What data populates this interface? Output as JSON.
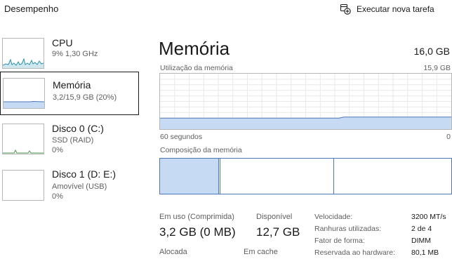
{
  "header": {
    "title": "Desempenho",
    "run_task_label": "Executar nova tarefa",
    "run_task_icon": "new-task-icon"
  },
  "sidebar": {
    "items": [
      {
        "title": "CPU",
        "sub1": "9%  1,30 GHz",
        "sub2": ""
      },
      {
        "title": "Memória",
        "sub1": "3,2/15,9 GB (20%)",
        "sub2": ""
      },
      {
        "title": "Disco 0 (C:)",
        "sub1": "SSD (RAID)",
        "sub2": "0%"
      },
      {
        "title": "Disco 1 (D: E:)",
        "sub1": "Amovível (USB)",
        "sub2": "0%"
      }
    ]
  },
  "main": {
    "title": "Memória",
    "total": "16,0 GB",
    "usage_label": "Utilização da memória",
    "usage_max": "15,9 GB",
    "time_span": "60 segundos",
    "time_end": "0",
    "composition_label": "Composição da memória",
    "usage_fraction": 0.2,
    "composition": {
      "in_use_gb": 3.2,
      "modified_gb": 0.0,
      "standby_gb": 6.2,
      "free_gb": 6.5,
      "total_gb": 15.9
    }
  },
  "stats": {
    "in_use_label": "Em uso (Comprimida)",
    "in_use_value": "3,2 GB (0 MB)",
    "available_label": "Disponível",
    "available_value": "12,7 GB",
    "committed_label": "Alocada",
    "cached_label": "Em cache"
  },
  "details": [
    {
      "key": "Velocidade:",
      "value": "3200 MT/s"
    },
    {
      "key": "Ranhuras utilizadas:",
      "value": "2 de 4"
    },
    {
      "key": "Fator de forma:",
      "value": "DIMM"
    },
    {
      "key": "Reservada ao hardware:",
      "value": "80,1 MB"
    }
  ],
  "colors": {
    "memory_fill": "#c7daf4",
    "memory_line": "#4d78b6",
    "cpu_line": "#2b92a8",
    "cpu_fill": "#cfe8ef",
    "disk_line": "#4e9a4e",
    "grid": "#e9e9e9"
  }
}
